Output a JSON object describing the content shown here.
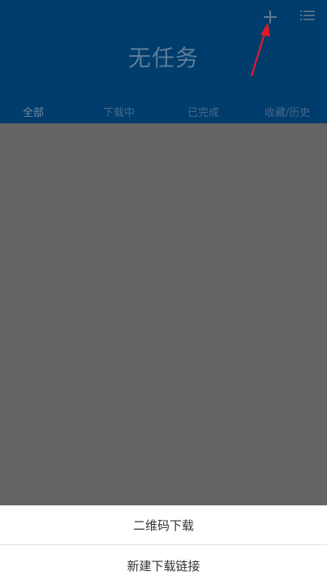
{
  "header": {
    "title": "无任务",
    "tabs": [
      {
        "label": "全部"
      },
      {
        "label": "下载中"
      },
      {
        "label": "已完成"
      },
      {
        "label": "收藏/历史"
      }
    ]
  },
  "icons": {
    "add": "plus-icon",
    "menu": "list-menu-icon",
    "pointer": "red-arrow-annotation"
  },
  "colors": {
    "header_bg": "#003c6c",
    "overlay": "#646464",
    "annotation_arrow": "#e0192b"
  },
  "action_sheet": {
    "items": [
      {
        "label": "二维码下载"
      },
      {
        "label": "新建下载链接"
      }
    ]
  }
}
